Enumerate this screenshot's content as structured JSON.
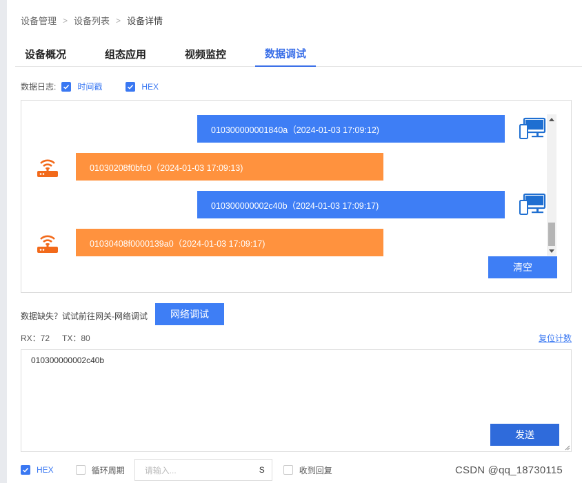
{
  "breadcrumb": [
    "设备管理",
    "设备列表",
    "设备详情"
  ],
  "tabs": [
    {
      "label": "设备概况",
      "active": false
    },
    {
      "label": "组态应用",
      "active": false
    },
    {
      "label": "视频监控",
      "active": false
    },
    {
      "label": "数据调试",
      "active": true
    }
  ],
  "log_options": {
    "label": "数据日志:",
    "timestamp": {
      "label": "时间戳",
      "checked": true
    },
    "hex": {
      "label": "HEX",
      "checked": true
    }
  },
  "log": {
    "messages": [
      {
        "direction": "out",
        "text": "010300000001840a（2024-01-03 17:09:12)",
        "icon": "computer-icon"
      },
      {
        "direction": "in",
        "text": "01030208f0bfc0（2024-01-03 17:09:13)",
        "icon": "router-icon"
      },
      {
        "direction": "out",
        "text": "010300000002c40b（2024-01-03 17:09:17)",
        "icon": "computer-icon"
      },
      {
        "direction": "in",
        "text": "01030408f0000139a0（2024-01-03 17:09:17)",
        "icon": "router-icon"
      }
    ],
    "clear_label": "清空"
  },
  "hint": {
    "text": "数据缺失？试试前往网关-网络调试",
    "button": "网络调试"
  },
  "counters": {
    "rx": "RX：72",
    "tx": "TX：80",
    "reset_label": "复位计数"
  },
  "send": {
    "value": "010300000002c40b",
    "button": "发送"
  },
  "bottom": {
    "hex": {
      "label": "HEX",
      "checked": true
    },
    "loop": {
      "label": "循环周期",
      "checked": false
    },
    "period_placeholder": "请输入...",
    "period_unit": "S",
    "reply": {
      "label": "收到回复",
      "checked": false
    }
  },
  "watermark": "CSDN @qq_18730115",
  "colors": {
    "accent": "#3a78f2",
    "outgoing": "#3e7ef5",
    "incoming": "#ff923e",
    "device_orange": "#f26a1b",
    "pc_blue": "#1f6fd1"
  }
}
